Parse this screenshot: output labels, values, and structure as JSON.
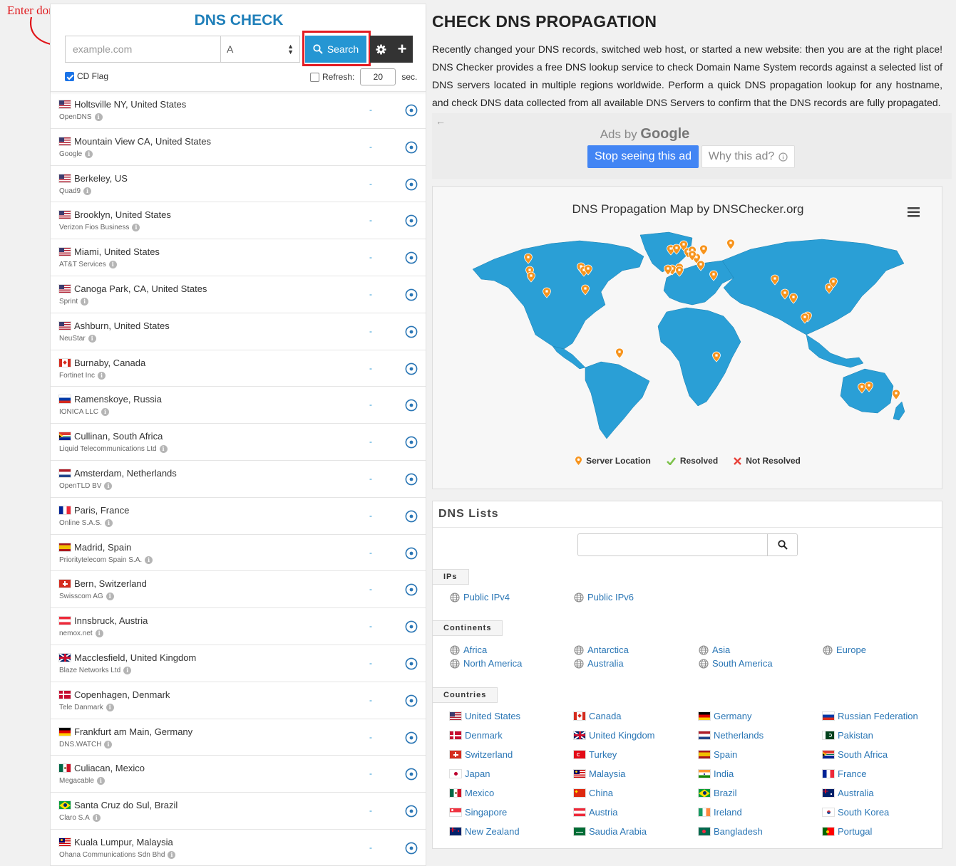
{
  "annotation": {
    "text": "Enter domain name"
  },
  "check": {
    "title": "DNS CHECK",
    "domain_placeholder": "example.com",
    "record_type": "A",
    "search_label": "Search",
    "cd_flag_label": "CD Flag",
    "refresh_label": "Refresh:",
    "refresh_value": "20",
    "refresh_unit": "sec."
  },
  "servers": [
    {
      "location": "Holtsville NY, United States",
      "provider": "OpenDNS",
      "flag": "us",
      "result": "-"
    },
    {
      "location": "Mountain View CA, United States",
      "provider": "Google",
      "flag": "us",
      "result": "-"
    },
    {
      "location": "Berkeley, US",
      "provider": "Quad9",
      "flag": "us",
      "result": "-"
    },
    {
      "location": "Brooklyn, United States",
      "provider": "Verizon Fios Business",
      "flag": "us",
      "result": "-"
    },
    {
      "location": "Miami, United States",
      "provider": "AT&T Services",
      "flag": "us",
      "result": "-"
    },
    {
      "location": "Canoga Park, CA, United States",
      "provider": "Sprint",
      "flag": "us",
      "result": "-"
    },
    {
      "location": "Ashburn, United States",
      "provider": "NeuStar",
      "flag": "us",
      "result": "-"
    },
    {
      "location": "Burnaby, Canada",
      "provider": "Fortinet Inc",
      "flag": "ca",
      "result": "-"
    },
    {
      "location": "Ramenskoye, Russia",
      "provider": "IONICA LLC",
      "flag": "ru",
      "result": "-"
    },
    {
      "location": "Cullinan, South Africa",
      "provider": "Liquid Telecommunications Ltd",
      "flag": "za",
      "result": "-"
    },
    {
      "location": "Amsterdam, Netherlands",
      "provider": "OpenTLD BV",
      "flag": "nl",
      "result": "-"
    },
    {
      "location": "Paris, France",
      "provider": "Online S.A.S.",
      "flag": "fr",
      "result": "-"
    },
    {
      "location": "Madrid, Spain",
      "provider": "Prioritytelecom Spain S.A.",
      "flag": "es",
      "result": "-"
    },
    {
      "location": "Bern, Switzerland",
      "provider": "Swisscom AG",
      "flag": "ch",
      "result": "-"
    },
    {
      "location": "Innsbruck, Austria",
      "provider": "nemox.net",
      "flag": "at",
      "result": "-"
    },
    {
      "location": "Macclesfield, United Kingdom",
      "provider": "Blaze Networks Ltd",
      "flag": "gb",
      "result": "-"
    },
    {
      "location": "Copenhagen, Denmark",
      "provider": "Tele Danmark",
      "flag": "dk",
      "result": "-"
    },
    {
      "location": "Frankfurt am Main, Germany",
      "provider": "DNS.WATCH",
      "flag": "de",
      "result": "-"
    },
    {
      "location": "Culiacan, Mexico",
      "provider": "Megacable",
      "flag": "mx",
      "result": "-"
    },
    {
      "location": "Santa Cruz do Sul, Brazil",
      "provider": "Claro S.A",
      "flag": "br",
      "result": "-"
    },
    {
      "location": "Kuala Lumpur, Malaysia",
      "provider": "Ohana Communications Sdn Bhd",
      "flag": "my",
      "result": "-"
    }
  ],
  "page": {
    "title": "CHECK DNS PROPAGATION",
    "description": "Recently changed your DNS records, switched web host, or started a new website: then you are at the right place! DNS Checker provides a free DNS lookup service to check Domain Name System records against a selected list of DNS servers located in multiple regions worldwide. Perform a quick DNS propagation lookup for any hostname, and check DNS data collected from all available DNS Servers to confirm that the DNS records are fully propagated."
  },
  "ad": {
    "back": "←",
    "ads_by": "Ads by",
    "google": "Google",
    "stop_label": "Stop seeing this ad",
    "why_label": "Why this ad?"
  },
  "map": {
    "title": "DNS Propagation Map by DNSChecker.org",
    "land_color": "#2a9fd6",
    "marker_color": "#f7941d",
    "legend": {
      "server": "Server Location",
      "resolved": "Resolved",
      "not_resolved": "Not Resolved"
    }
  },
  "dns_lists": {
    "title": "DNS Lists",
    "ips_label": "IPs",
    "ips": [
      "Public IPv4",
      "Public IPv6"
    ],
    "continents_label": "Continents",
    "continents": [
      "Africa",
      "Antarctica",
      "Asia",
      "Europe",
      "North America",
      "Australia",
      "South America"
    ],
    "countries_label": "Countries",
    "countries": [
      {
        "name": "United States",
        "flag": "us"
      },
      {
        "name": "Canada",
        "flag": "ca"
      },
      {
        "name": "Germany",
        "flag": "de"
      },
      {
        "name": "Russian Federation",
        "flag": "ru"
      },
      {
        "name": "Denmark",
        "flag": "dk"
      },
      {
        "name": "United Kingdom",
        "flag": "gb"
      },
      {
        "name": "Netherlands",
        "flag": "nl"
      },
      {
        "name": "Pakistan",
        "flag": "pk"
      },
      {
        "name": "Switzerland",
        "flag": "ch"
      },
      {
        "name": "Turkey",
        "flag": "tr"
      },
      {
        "name": "Spain",
        "flag": "es"
      },
      {
        "name": "South Africa",
        "flag": "za"
      },
      {
        "name": "Japan",
        "flag": "jp"
      },
      {
        "name": "Malaysia",
        "flag": "my"
      },
      {
        "name": "India",
        "flag": "in"
      },
      {
        "name": "France",
        "flag": "fr"
      },
      {
        "name": "Mexico",
        "flag": "mx"
      },
      {
        "name": "China",
        "flag": "cn"
      },
      {
        "name": "Brazil",
        "flag": "br"
      },
      {
        "name": "Australia",
        "flag": "au"
      },
      {
        "name": "Singapore",
        "flag": "sg"
      },
      {
        "name": "Austria",
        "flag": "at"
      },
      {
        "name": "Ireland",
        "flag": "ie"
      },
      {
        "name": "South Korea",
        "flag": "kr"
      },
      {
        "name": "New Zealand",
        "flag": "nz"
      },
      {
        "name": "Saudia Arabia",
        "flag": "sa"
      },
      {
        "name": "Bangladesh",
        "flag": "bd"
      },
      {
        "name": "Portugal",
        "flag": "pt"
      }
    ]
  }
}
